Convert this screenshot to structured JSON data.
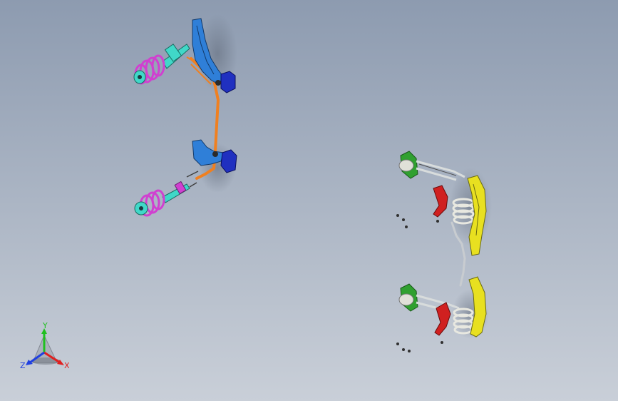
{
  "viewport": {
    "background_top": "#8d9bb0",
    "background_bottom": "#c9cfd8"
  },
  "triad": {
    "x_label": "X",
    "y_label": "Y",
    "z_label": "Z",
    "x_color": "#e02020",
    "y_color": "#20c020",
    "z_color": "#2040e0"
  },
  "parts": {
    "front_strut_color": "#d040d0",
    "front_damper_color": "#40d8c8",
    "front_arm_color": "#2f7fd8",
    "front_subframe_block_color": "#2030c0",
    "front_stabilizer_color": "#f08020",
    "rear_knuckle_color": "#e8e020",
    "rear_upper_arm_color": "#d02020",
    "rear_mount_color": "#30a030",
    "rear_spring_color": "#e8e8e0",
    "rear_stabilizer_color": "#c8ccd0"
  }
}
